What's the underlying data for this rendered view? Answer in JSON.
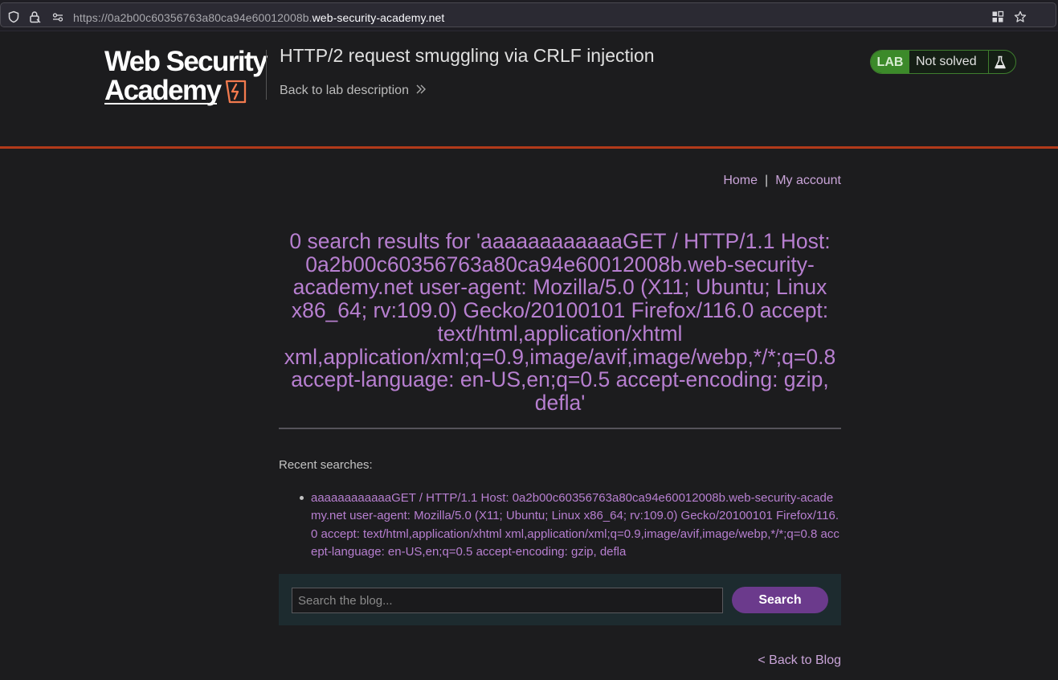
{
  "browser": {
    "url_prefix": "https://0a2b00c60356763a80ca94e60012008b.",
    "url_domain": "web-security-academy.net",
    "icons": [
      "shield-icon",
      "lock-icon",
      "permissions-icon",
      "extensions-grid-icon",
      "star-icon"
    ]
  },
  "header": {
    "logo_line1": "Web Security",
    "logo_line2": "Academy",
    "lab_title": "HTTP/2 request smuggling via CRLF injection",
    "back_to_description": "Back to lab description",
    "status_badge": "LAB",
    "status_text": "Not solved",
    "accent_color": "#b23a1a"
  },
  "nav": {
    "home": "Home",
    "separator": "|",
    "my_account": "My account"
  },
  "results": {
    "heading": "0 search results for 'aaaaaaaaaaaaGET / HTTP/1.1 Host: 0a2b00c60356763a80ca94e60012008b.web-security-academy.net user-agent: Mozilla/5.0 (X11; Ubuntu; Linux x86_64; rv:109.0) Gecko/20100101 Firefox/116.0 accept: text/html,application/xhtml xml,application/xml;q=0.9,image/avif,image/webp,*/*;q=0.8 accept-language: en-US,en;q=0.5 accept-encoding: gzip, defla'"
  },
  "recent": {
    "label": "Recent searches:",
    "items": [
      "aaaaaaaaaaaaGET / HTTP/1.1 Host: 0a2b00c60356763a80ca94e60012008b.web-security-academy.net user-agent: Mozilla/5.0 (X11; Ubuntu; Linux x86_64; rv:109.0) Gecko/20100101 Firefox/116.0 accept: text/html,application/xhtml xml,application/xml;q=0.9,image/avif,image/webp,*/*;q=0.8 accept-language: en-US,en;q=0.5 accept-encoding: gzip, defla"
    ]
  },
  "search": {
    "placeholder": "Search the blog...",
    "value": "",
    "button": "Search"
  },
  "footer": {
    "back_to_blog": "< Back to Blog"
  }
}
